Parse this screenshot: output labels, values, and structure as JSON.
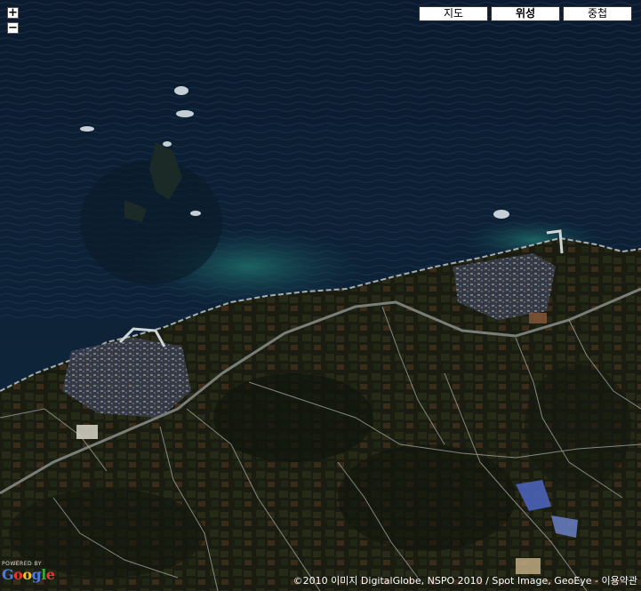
{
  "map": {
    "zoom_in": "+",
    "zoom_out": "−",
    "map_types": [
      {
        "label": "지도",
        "active": false
      },
      {
        "label": "위성",
        "active": true
      },
      {
        "label": "중첩",
        "active": false
      }
    ],
    "logo": {
      "powered_by": "POWERED BY",
      "letters": [
        "G",
        "o",
        "o",
        "g",
        "l",
        "e"
      ]
    },
    "attribution": "©2010 이미지 DigitalGlobe, NSPO 2010 / Spot Image, GeoEye - ",
    "terms_link": "이용약관"
  }
}
